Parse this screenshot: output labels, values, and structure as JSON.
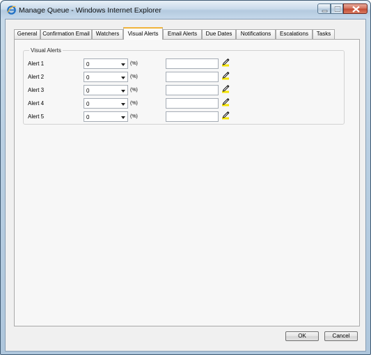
{
  "window": {
    "title": "Manage Queue - Windows Internet Explorer"
  },
  "tabs": [
    {
      "label": "General"
    },
    {
      "label": "Confirmation Email"
    },
    {
      "label": "Watchers"
    },
    {
      "label": "Visual Alerts",
      "active": true
    },
    {
      "label": "Email Alerts"
    },
    {
      "label": "Due Dates"
    },
    {
      "label": "Notifications"
    },
    {
      "label": "Escalations"
    },
    {
      "label": "Tasks"
    }
  ],
  "visual_alerts": {
    "legend": "Visual Alerts",
    "rows": [
      {
        "label": "Alert 1",
        "percent_value": "0",
        "unit": "(%)",
        "color_value": ""
      },
      {
        "label": "Alert 2",
        "percent_value": "0",
        "unit": "(%)",
        "color_value": ""
      },
      {
        "label": "Alert 3",
        "percent_value": "0",
        "unit": "(%)",
        "color_value": ""
      },
      {
        "label": "Alert 4",
        "percent_value": "0",
        "unit": "(%)",
        "color_value": ""
      },
      {
        "label": "Alert 5",
        "percent_value": "0",
        "unit": "(%)",
        "color_value": ""
      }
    ]
  },
  "buttons": {
    "ok": "OK",
    "cancel": "Cancel"
  },
  "colors": {
    "active_tab_accent": "#f0b43b",
    "pencil_highlight": "#f5e400"
  }
}
